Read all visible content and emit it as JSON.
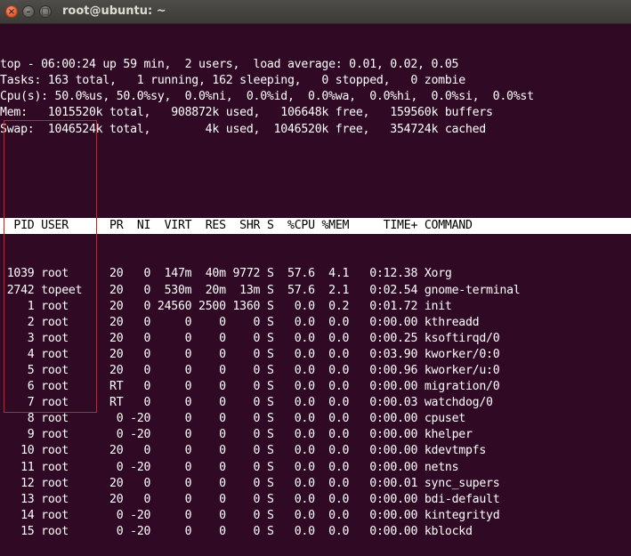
{
  "window": {
    "title": "root@ubuntu: ~",
    "close_glyph": "×",
    "min_glyph": "–",
    "max_glyph": "□"
  },
  "summary": [
    "top - 06:00:24 up 59 min,  2 users,  load average: 0.01, 0.02, 0.05",
    "Tasks: 163 total,   1 running, 162 sleeping,   0 stopped,   0 zombie",
    "Cpu(s): 50.0%us, 50.0%sy,  0.0%ni,  0.0%id,  0.0%wa,  0.0%hi,  0.0%si,  0.0%st",
    "Mem:   1015520k total,   908872k used,   106648k free,   159560k buffers",
    "Swap:  1046524k total,        4k used,  1046520k free,   354724k cached"
  ],
  "columns": [
    "PID",
    "USER",
    "PR",
    "NI",
    "VIRT",
    "RES",
    "SHR",
    "S",
    "%CPU",
    "%MEM",
    "TIME+",
    "COMMAND"
  ],
  "processes": [
    [
      "1039",
      "root",
      "20",
      "0",
      "147m",
      "40m",
      "9772",
      "S",
      "57.6",
      "4.1",
      "0:12.38",
      "Xorg"
    ],
    [
      "2742",
      "topeet",
      "20",
      "0",
      "530m",
      "20m",
      "13m",
      "S",
      "57.6",
      "2.1",
      "0:02.54",
      "gnome-terminal"
    ],
    [
      "1",
      "root",
      "20",
      "0",
      "24560",
      "2500",
      "1360",
      "S",
      "0.0",
      "0.2",
      "0:01.72",
      "init"
    ],
    [
      "2",
      "root",
      "20",
      "0",
      "0",
      "0",
      "0",
      "S",
      "0.0",
      "0.0",
      "0:00.00",
      "kthreadd"
    ],
    [
      "3",
      "root",
      "20",
      "0",
      "0",
      "0",
      "0",
      "S",
      "0.0",
      "0.0",
      "0:00.25",
      "ksoftirqd/0"
    ],
    [
      "4",
      "root",
      "20",
      "0",
      "0",
      "0",
      "0",
      "S",
      "0.0",
      "0.0",
      "0:03.90",
      "kworker/0:0"
    ],
    [
      "5",
      "root",
      "20",
      "0",
      "0",
      "0",
      "0",
      "S",
      "0.0",
      "0.0",
      "0:00.96",
      "kworker/u:0"
    ],
    [
      "6",
      "root",
      "RT",
      "0",
      "0",
      "0",
      "0",
      "S",
      "0.0",
      "0.0",
      "0:00.00",
      "migration/0"
    ],
    [
      "7",
      "root",
      "RT",
      "0",
      "0",
      "0",
      "0",
      "S",
      "0.0",
      "0.0",
      "0:00.03",
      "watchdog/0"
    ],
    [
      "8",
      "root",
      "0",
      "-20",
      "0",
      "0",
      "0",
      "S",
      "0.0",
      "0.0",
      "0:00.00",
      "cpuset"
    ],
    [
      "9",
      "root",
      "0",
      "-20",
      "0",
      "0",
      "0",
      "S",
      "0.0",
      "0.0",
      "0:00.00",
      "khelper"
    ],
    [
      "10",
      "root",
      "20",
      "0",
      "0",
      "0",
      "0",
      "S",
      "0.0",
      "0.0",
      "0:00.00",
      "kdevtmpfs"
    ],
    [
      "11",
      "root",
      "0",
      "-20",
      "0",
      "0",
      "0",
      "S",
      "0.0",
      "0.0",
      "0:00.00",
      "netns"
    ],
    [
      "12",
      "root",
      "20",
      "0",
      "0",
      "0",
      "0",
      "S",
      "0.0",
      "0.0",
      "0:00.01",
      "sync_supers"
    ],
    [
      "13",
      "root",
      "20",
      "0",
      "0",
      "0",
      "0",
      "S",
      "0.0",
      "0.0",
      "0:00.00",
      "bdi-default"
    ],
    [
      "14",
      "root",
      "0",
      "-20",
      "0",
      "0",
      "0",
      "S",
      "0.0",
      "0.0",
      "0:00.00",
      "kintegrityd"
    ],
    [
      "15",
      "root",
      "0",
      "-20",
      "0",
      "0",
      "0",
      "S",
      "0.0",
      "0.0",
      "0:00.00",
      "kblockd"
    ]
  ],
  "colors": {
    "terminal_bg": "#300a24",
    "terminal_fg": "#ffffff",
    "header_bg": "#ffffff",
    "header_fg": "#000000",
    "highlight_box": "#d41e1e"
  }
}
